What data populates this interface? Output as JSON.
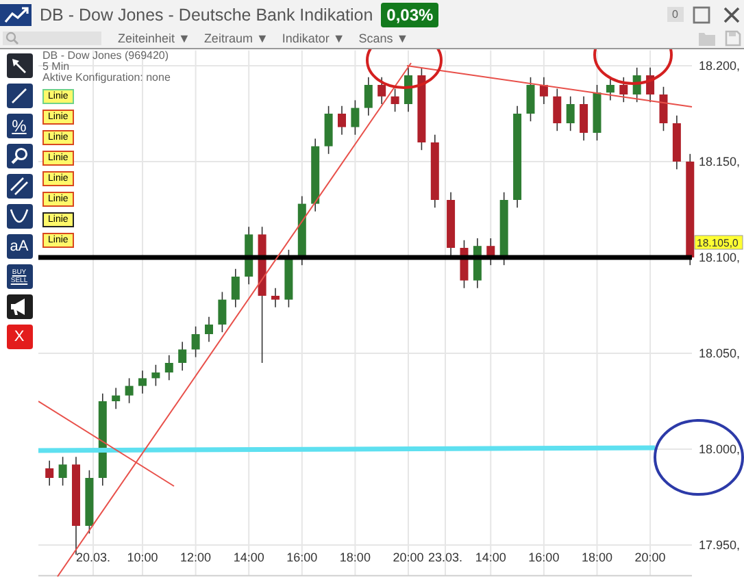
{
  "header": {
    "title": "DB - Dow Jones - Deutsche Bank Indikation",
    "change": "0,03%",
    "count": "0"
  },
  "menus": [
    {
      "label": "Zeiteinheit",
      "caret": "▼"
    },
    {
      "label": "Zeitraum",
      "caret": "▼"
    },
    {
      "label": "Indikator",
      "caret": "▼"
    },
    {
      "label": "Scans",
      "caret": "▼"
    }
  ],
  "tools": [
    {
      "kind": "arrow",
      "selected": true
    },
    {
      "kind": "line",
      "selected": false
    },
    {
      "kind": "percent",
      "label": "%",
      "selected": false
    },
    {
      "kind": "search",
      "selected": false
    },
    {
      "kind": "parallel",
      "selected": false
    },
    {
      "kind": "curve",
      "selected": false
    },
    {
      "kind": "text",
      "label": "aA",
      "selected": false
    },
    {
      "kind": "buysell",
      "labels": [
        "BUY",
        "SELL"
      ],
      "selected": false
    },
    {
      "kind": "megaphone",
      "selected": false
    },
    {
      "kind": "delete",
      "label": "X",
      "selected": false
    }
  ],
  "legend": {
    "instrument": "DB - Dow Jones (969420)",
    "interval": "5 Min",
    "config": "Aktive Konfiguration: none",
    "lines": [
      {
        "label": "Linie",
        "color": "#6fd38a"
      },
      {
        "label": "Linie",
        "color": "#d9481f"
      },
      {
        "label": "Linie",
        "color": "#d9481f"
      },
      {
        "label": "Linie",
        "color": "#d9481f"
      },
      {
        "label": "Linie",
        "color": "#d9481f"
      },
      {
        "label": "Linie",
        "color": "#d9481f"
      },
      {
        "label": "Linie",
        "color": "#222222"
      },
      {
        "label": "Linie",
        "color": "#d9481f"
      }
    ]
  },
  "price_tag": "18.105,0",
  "date_labels": [
    "20.03.",
    "23.03."
  ],
  "day2_time_labels": [
    "14:00",
    "16:00",
    "18:00",
    "20:00"
  ],
  "chart_data": {
    "type": "candlestick",
    "grid": true,
    "x": [
      6.5,
      7,
      7.5,
      8,
      8.5,
      9,
      9.5,
      10,
      10.5,
      11,
      11.5,
      12,
      12.5,
      13,
      13.5,
      14,
      14.5,
      15,
      15.5,
      16,
      16.5,
      17,
      17.5,
      18,
      18.5,
      19,
      19.5,
      20,
      20.5,
      21,
      21.6,
      22.1,
      22.6,
      23.1,
      23.6,
      24.1,
      24.6,
      25.1,
      25.6,
      26.1,
      26.6,
      27.1,
      27.6,
      28.1,
      28.6,
      29.1,
      29.6,
      30.1,
      30.6
    ],
    "ohlc": [
      [
        17990,
        17994,
        17981,
        17985
      ],
      [
        17985,
        17996,
        17981,
        17992
      ],
      [
        17992,
        17996,
        17945,
        17960
      ],
      [
        17960,
        17989,
        17956,
        17985
      ],
      [
        17985,
        18029,
        17981,
        18025
      ],
      [
        18025,
        18032,
        18021,
        18028
      ],
      [
        18028,
        18037,
        18024,
        18033
      ],
      [
        18033,
        18041,
        18029,
        18037
      ],
      [
        18037,
        18044,
        18033,
        18040
      ],
      [
        18040,
        18049,
        18036,
        18045
      ],
      [
        18045,
        18056,
        18041,
        18052
      ],
      [
        18052,
        18064,
        18048,
        18060
      ],
      [
        18060,
        18069,
        18056,
        18065
      ],
      [
        18065,
        18082,
        18061,
        18078
      ],
      [
        18078,
        18094,
        18074,
        18090
      ],
      [
        18090,
        18116,
        18086,
        18112
      ],
      [
        18112,
        18116,
        18045,
        18080
      ],
      [
        18080,
        18084,
        18074,
        18078
      ],
      [
        18078,
        18104,
        18074,
        18100
      ],
      [
        18100,
        18132,
        18096,
        18128
      ],
      [
        18128,
        18162,
        18124,
        18158
      ],
      [
        18158,
        18179,
        18154,
        18175
      ],
      [
        18175,
        18179,
        18164,
        18168
      ],
      [
        18168,
        18182,
        18164,
        18178
      ],
      [
        18178,
        18194,
        18174,
        18190
      ],
      [
        18190,
        18194,
        18180,
        18184
      ],
      [
        18184,
        18188,
        18176,
        18180
      ],
      [
        18180,
        18199,
        18176,
        18195
      ],
      [
        18195,
        18199,
        18156,
        18160
      ],
      [
        18160,
        18164,
        18126,
        18130
      ],
      [
        18130,
        18134,
        18101,
        18105
      ],
      [
        18105,
        18109,
        18084,
        18088
      ],
      [
        18088,
        18110,
        18084,
        18106
      ],
      [
        18106,
        18110,
        18096,
        18100
      ],
      [
        18100,
        18134,
        18096,
        18130
      ],
      [
        18130,
        18179,
        18126,
        18175
      ],
      [
        18175,
        18194,
        18171,
        18190
      ],
      [
        18190,
        18194,
        18180,
        18184
      ],
      [
        18184,
        18188,
        18166,
        18170
      ],
      [
        18170,
        18184,
        18166,
        18180
      ],
      [
        18180,
        18184,
        18161,
        18165
      ],
      [
        18165,
        18190,
        18161,
        18186
      ],
      [
        18186,
        18194,
        18182,
        18190
      ],
      [
        18190,
        18194,
        18181,
        18185
      ],
      [
        18185,
        18199,
        18181,
        18195
      ],
      [
        18195,
        18199,
        18181,
        18185
      ],
      [
        18185,
        18189,
        18166,
        18170
      ],
      [
        18170,
        18174,
        18146,
        18150
      ],
      [
        18150,
        18154,
        18096,
        18100
      ]
    ],
    "xticks": [
      {
        "value": 10,
        "label": "10:00"
      },
      {
        "value": 12,
        "label": "12:00"
      },
      {
        "value": 14,
        "label": "14:00"
      },
      {
        "value": 16,
        "label": "16:00"
      },
      {
        "value": 18,
        "label": "18:00"
      },
      {
        "value": 20,
        "label": "20:00"
      }
    ],
    "xlim": [
      6.08,
      30.67
    ],
    "ylim": [
      17934,
      18208
    ],
    "yticks": [
      {
        "value": 18200,
        "label": "18.200,"
      },
      {
        "value": 18150,
        "label": "18.150,"
      },
      {
        "value": 18100,
        "label": "18.100,"
      },
      {
        "value": 18050,
        "label": "18.050,"
      },
      {
        "value": 18000,
        "label": "18.000,"
      },
      {
        "value": 17950,
        "label": "17.950,"
      }
    ]
  }
}
